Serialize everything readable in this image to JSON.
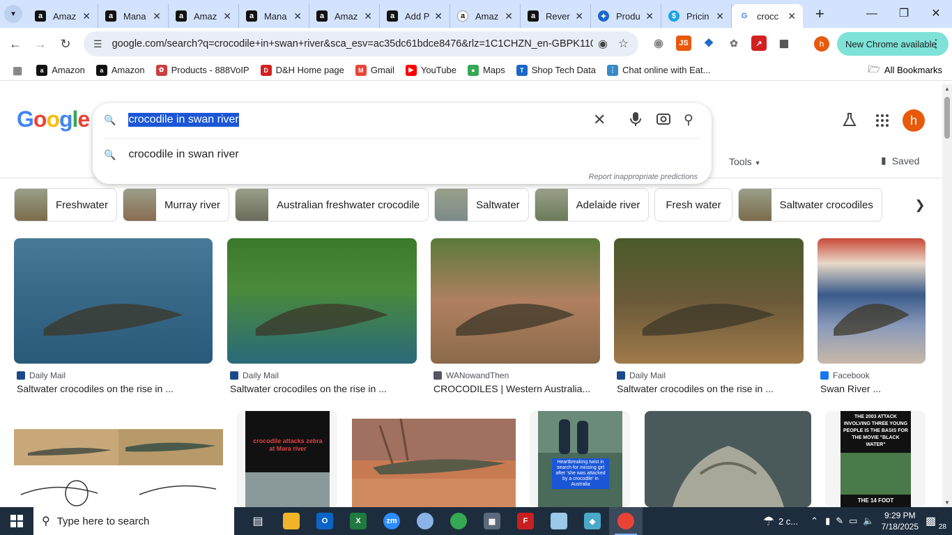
{
  "browser": {
    "tabs": [
      {
        "title": "Amaz",
        "icon": "amazon-icon",
        "active": false
      },
      {
        "title": "Mana",
        "icon": "amazon-icon",
        "active": false
      },
      {
        "title": "Amaz",
        "icon": "amazon-icon",
        "active": false
      },
      {
        "title": "Mana",
        "icon": "amazon-icon",
        "active": false
      },
      {
        "title": "Amaz",
        "icon": "amazon-icon",
        "active": false
      },
      {
        "title": "Add P",
        "icon": "amazon-icon",
        "active": false
      },
      {
        "title": "Amaz",
        "icon": "amazon-smile-icon",
        "active": false
      },
      {
        "title": "Rever",
        "icon": "amazon-icon",
        "active": false
      },
      {
        "title": "Produ",
        "icon": "product-icon",
        "active": false
      },
      {
        "title": "Pricin",
        "icon": "dollar-icon",
        "active": false
      },
      {
        "title": "crocc",
        "icon": "google-icon",
        "active": true
      }
    ],
    "url": "google.com/search?q=crocodile+in+swan+river&sca_esv=ac35dc61bdce8476&rlz=1C1CHZN_en-GBPK1108...",
    "new_chrome_label": "New Chrome available",
    "profile_initial": "h",
    "bookmarks": [
      {
        "label": "Amazon",
        "icon": "amazon-icon"
      },
      {
        "label": "Amazon",
        "icon": "amazon-icon"
      },
      {
        "label": "Products - 888VoIP",
        "icon": "888voip-icon"
      },
      {
        "label": "D&H Home page",
        "icon": "dh-icon"
      },
      {
        "label": "Gmail",
        "icon": "gmail-icon"
      },
      {
        "label": "YouTube",
        "icon": "youtube-icon"
      },
      {
        "label": "Maps",
        "icon": "maps-icon"
      },
      {
        "label": "Shop Tech Data",
        "icon": "techdata-icon"
      },
      {
        "label": "Chat online with Eat...",
        "icon": "chat-icon"
      }
    ],
    "all_bookmarks_label": "All Bookmarks"
  },
  "search": {
    "query": "crocodile in swan river",
    "suggestion": "crocodile in swan river",
    "report_label": "Report inappropriate predictions",
    "tools_label": "Tools",
    "saved_label": "Saved",
    "avatar_initial": "h"
  },
  "chips": [
    {
      "label": "Freshwater",
      "has_thumb": true,
      "color": "#7a6a4a"
    },
    {
      "label": "Murray river",
      "has_thumb": true,
      "color": "#8a6a50"
    },
    {
      "label": "Australian freshwater crocodile",
      "has_thumb": true,
      "color": "#6a6a5a"
    },
    {
      "label": "Saltwater",
      "has_thumb": true,
      "color": "#7a8a8a"
    },
    {
      "label": "Adelaide river",
      "has_thumb": true,
      "color": "#6a7a5a"
    },
    {
      "label": "Fresh water",
      "has_thumb": false,
      "color": "#ffffff"
    },
    {
      "label": "Saltwater crocodiles",
      "has_thumb": true,
      "color": "#7a6a4a"
    }
  ],
  "results_row1": [
    {
      "source": "Daily Mail",
      "title": "Saltwater crocodiles on the rise in ...",
      "source_icon": "dailymail-icon"
    },
    {
      "source": "Daily Mail",
      "title": "Saltwater crocodiles on the rise in ...",
      "source_icon": "dailymail-icon"
    },
    {
      "source": "WANowandThen",
      "title": "CROCODILES | Western Australia...",
      "source_icon": "wanowandthen-icon"
    },
    {
      "source": "Daily Mail",
      "title": "Saltwater crocodiles on the rise in ...",
      "source_icon": "dailymail-icon"
    },
    {
      "source": "Facebook",
      "title": "Swan River ...",
      "source_icon": "facebook-icon"
    }
  ],
  "results_row2_text": {
    "zebra": "crocodile attacks zebra at Mara river",
    "police": "Heartbreaking twist in search for missing girl after 'she was attacked by a crocodile' in Australia",
    "movie": "THE 2003 ATTACK INVOLVING THREE YOUNG PEOPLE IS THE BASIS FOR THE MOVIE \"BLACK WATER\"",
    "movie_bottom": "THE 14 FOOT"
  },
  "taskbar": {
    "search_placeholder": "Type here to search",
    "weather": "2 c...",
    "time": "9:29 PM",
    "date": "7/18/2025",
    "notifications": "28"
  }
}
